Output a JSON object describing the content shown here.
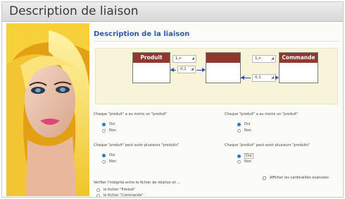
{
  "window": {
    "title": "Description de liaison"
  },
  "dialog": {
    "heading": "Description de la liaison",
    "entities": {
      "left": "Produit",
      "middle": "",
      "right": "Commande"
    },
    "cards": {
      "left_max": "1,n",
      "left_min": "0,1",
      "right_max": "1,n",
      "right_min": "0,1"
    },
    "questions": {
      "q1_left": "Chaque \"produit\" a au moins un \"produit\"",
      "q1_right": "Chaque \"produit\" a au moins un \"produit\"",
      "q2_left": "Chaque \"produit\" peut avoir plusieurs \"produits\"",
      "q2_right": "Chaque \"produit\" peut avoir plusieurs \"produits\""
    },
    "options": {
      "oui": "Oui",
      "non": "Non"
    },
    "show_cardinalities": "Afficher les cardinalités avancées",
    "integrity": {
      "label": "Vérifier l'intégrité entre le fichier de relation et ...",
      "file1": "le fichier \"Produit\"",
      "file2": "le fichier \"Commande\""
    }
  },
  "colors": {
    "entity_header": "#8f3830",
    "accent": "#2a5aa8",
    "radio_on": "#1f7ed6",
    "diagram_bg": "#f7f4d9"
  }
}
